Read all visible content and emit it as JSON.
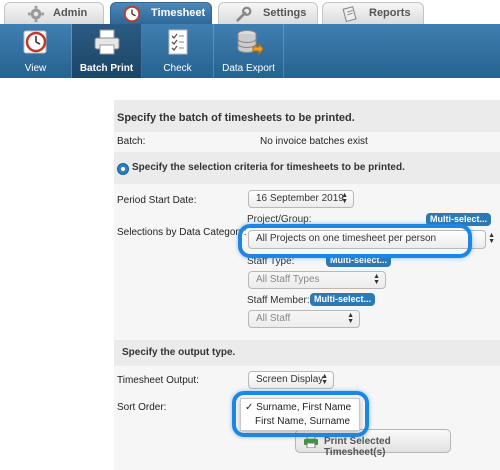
{
  "tabs": [
    {
      "label": "Admin",
      "icon": "gear-icon"
    },
    {
      "label": "Timesheet",
      "icon": "clock-icon"
    },
    {
      "label": "Settings",
      "icon": "wrench-icon"
    },
    {
      "label": "Reports",
      "icon": "report-icon"
    }
  ],
  "toolbar": {
    "items": [
      {
        "label": "View",
        "icon": "calendar-clock-icon"
      },
      {
        "label": "Batch Print",
        "icon": "printer-icon"
      },
      {
        "label": "Check",
        "icon": "checklist-icon"
      },
      {
        "label": "Data Export",
        "icon": "database-export-icon"
      }
    ]
  },
  "form": {
    "batch_heading": "Specify the batch of timesheets to be printed.",
    "batch_label": "Batch:",
    "batch_value": "No invoice batches exist",
    "selection_heading": "Specify the selection criteria for timesheets to be printed.",
    "period_label": "Period Start Date:",
    "period_value": "16 September 2019",
    "data_category_label": "Selections by Data Category:",
    "project_label": "Project/Group:",
    "project_value": "All Projects on one timesheet per person",
    "multi_select": "Multi-select...",
    "staff_type_label": "Staff Type:",
    "staff_type_value": "All Staff Types",
    "staff_member_label": "Staff Member:",
    "staff_member_value": "All Staff",
    "output_heading": "Specify the output type.",
    "output_label": "Timesheet Output:",
    "output_value": "Screen Display",
    "sort_label": "Sort Order:",
    "sort_options": [
      "Surname, First Name",
      "First Name, Surname"
    ],
    "sort_check": "✓",
    "print_button": "Print Selected Timesheet(s)"
  },
  "colors": {
    "accent": "#2d79b3",
    "highlight": "#1d86e3",
    "toolbar": "#3f7fb1"
  }
}
